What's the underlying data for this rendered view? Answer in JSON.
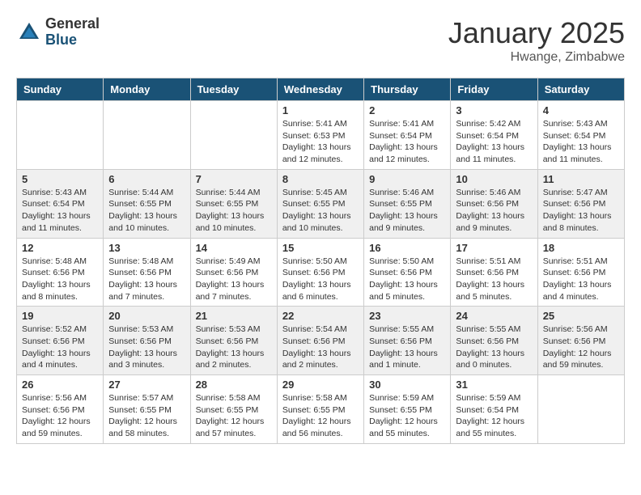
{
  "header": {
    "logo_general": "General",
    "logo_blue": "Blue",
    "month_title": "January 2025",
    "location": "Hwange, Zimbabwe"
  },
  "weekdays": [
    "Sunday",
    "Monday",
    "Tuesday",
    "Wednesday",
    "Thursday",
    "Friday",
    "Saturday"
  ],
  "weeks": [
    [
      {
        "day": "",
        "info": ""
      },
      {
        "day": "",
        "info": ""
      },
      {
        "day": "",
        "info": ""
      },
      {
        "day": "1",
        "info": "Sunrise: 5:41 AM\nSunset: 6:53 PM\nDaylight: 13 hours\nand 12 minutes."
      },
      {
        "day": "2",
        "info": "Sunrise: 5:41 AM\nSunset: 6:54 PM\nDaylight: 13 hours\nand 12 minutes."
      },
      {
        "day": "3",
        "info": "Sunrise: 5:42 AM\nSunset: 6:54 PM\nDaylight: 13 hours\nand 11 minutes."
      },
      {
        "day": "4",
        "info": "Sunrise: 5:43 AM\nSunset: 6:54 PM\nDaylight: 13 hours\nand 11 minutes."
      }
    ],
    [
      {
        "day": "5",
        "info": "Sunrise: 5:43 AM\nSunset: 6:54 PM\nDaylight: 13 hours\nand 11 minutes."
      },
      {
        "day": "6",
        "info": "Sunrise: 5:44 AM\nSunset: 6:55 PM\nDaylight: 13 hours\nand 10 minutes."
      },
      {
        "day": "7",
        "info": "Sunrise: 5:44 AM\nSunset: 6:55 PM\nDaylight: 13 hours\nand 10 minutes."
      },
      {
        "day": "8",
        "info": "Sunrise: 5:45 AM\nSunset: 6:55 PM\nDaylight: 13 hours\nand 10 minutes."
      },
      {
        "day": "9",
        "info": "Sunrise: 5:46 AM\nSunset: 6:55 PM\nDaylight: 13 hours\nand 9 minutes."
      },
      {
        "day": "10",
        "info": "Sunrise: 5:46 AM\nSunset: 6:56 PM\nDaylight: 13 hours\nand 9 minutes."
      },
      {
        "day": "11",
        "info": "Sunrise: 5:47 AM\nSunset: 6:56 PM\nDaylight: 13 hours\nand 8 minutes."
      }
    ],
    [
      {
        "day": "12",
        "info": "Sunrise: 5:48 AM\nSunset: 6:56 PM\nDaylight: 13 hours\nand 8 minutes."
      },
      {
        "day": "13",
        "info": "Sunrise: 5:48 AM\nSunset: 6:56 PM\nDaylight: 13 hours\nand 7 minutes."
      },
      {
        "day": "14",
        "info": "Sunrise: 5:49 AM\nSunset: 6:56 PM\nDaylight: 13 hours\nand 7 minutes."
      },
      {
        "day": "15",
        "info": "Sunrise: 5:50 AM\nSunset: 6:56 PM\nDaylight: 13 hours\nand 6 minutes."
      },
      {
        "day": "16",
        "info": "Sunrise: 5:50 AM\nSunset: 6:56 PM\nDaylight: 13 hours\nand 5 minutes."
      },
      {
        "day": "17",
        "info": "Sunrise: 5:51 AM\nSunset: 6:56 PM\nDaylight: 13 hours\nand 5 minutes."
      },
      {
        "day": "18",
        "info": "Sunrise: 5:51 AM\nSunset: 6:56 PM\nDaylight: 13 hours\nand 4 minutes."
      }
    ],
    [
      {
        "day": "19",
        "info": "Sunrise: 5:52 AM\nSunset: 6:56 PM\nDaylight: 13 hours\nand 4 minutes."
      },
      {
        "day": "20",
        "info": "Sunrise: 5:53 AM\nSunset: 6:56 PM\nDaylight: 13 hours\nand 3 minutes."
      },
      {
        "day": "21",
        "info": "Sunrise: 5:53 AM\nSunset: 6:56 PM\nDaylight: 13 hours\nand 2 minutes."
      },
      {
        "day": "22",
        "info": "Sunrise: 5:54 AM\nSunset: 6:56 PM\nDaylight: 13 hours\nand 2 minutes."
      },
      {
        "day": "23",
        "info": "Sunrise: 5:55 AM\nSunset: 6:56 PM\nDaylight: 13 hours\nand 1 minute."
      },
      {
        "day": "24",
        "info": "Sunrise: 5:55 AM\nSunset: 6:56 PM\nDaylight: 13 hours\nand 0 minutes."
      },
      {
        "day": "25",
        "info": "Sunrise: 5:56 AM\nSunset: 6:56 PM\nDaylight: 12 hours\nand 59 minutes."
      }
    ],
    [
      {
        "day": "26",
        "info": "Sunrise: 5:56 AM\nSunset: 6:56 PM\nDaylight: 12 hours\nand 59 minutes."
      },
      {
        "day": "27",
        "info": "Sunrise: 5:57 AM\nSunset: 6:55 PM\nDaylight: 12 hours\nand 58 minutes."
      },
      {
        "day": "28",
        "info": "Sunrise: 5:58 AM\nSunset: 6:55 PM\nDaylight: 12 hours\nand 57 minutes."
      },
      {
        "day": "29",
        "info": "Sunrise: 5:58 AM\nSunset: 6:55 PM\nDaylight: 12 hours\nand 56 minutes."
      },
      {
        "day": "30",
        "info": "Sunrise: 5:59 AM\nSunset: 6:55 PM\nDaylight: 12 hours\nand 55 minutes."
      },
      {
        "day": "31",
        "info": "Sunrise: 5:59 AM\nSunset: 6:54 PM\nDaylight: 12 hours\nand 55 minutes."
      },
      {
        "day": "",
        "info": ""
      }
    ]
  ]
}
